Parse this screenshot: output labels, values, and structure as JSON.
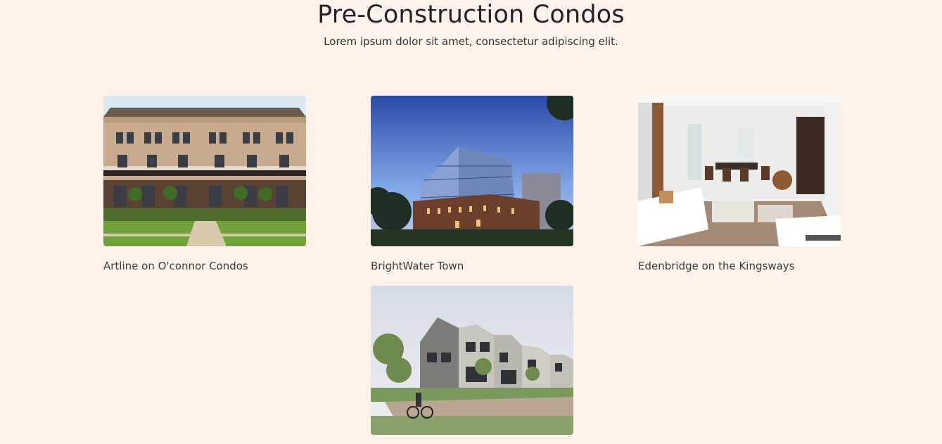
{
  "header": {
    "title": "Pre-Construction Condos",
    "subtitle": "Lorem ipsum dolor sit amet, consectetur adipiscing elit."
  },
  "listings": [
    {
      "name": "Artline on O'connor Condos",
      "image": "townhouse-facade-image"
    },
    {
      "name": "BrightWater Town",
      "image": "glass-building-dusk-image"
    },
    {
      "name": "Edenbridge on the Kingsways",
      "image": "interior-living-room-image"
    },
    {
      "name": "",
      "image": "modern-townhomes-street-image"
    }
  ],
  "colors": {
    "background": "#fff2eb",
    "title": "#23232b",
    "text": "#3a3a3a"
  }
}
